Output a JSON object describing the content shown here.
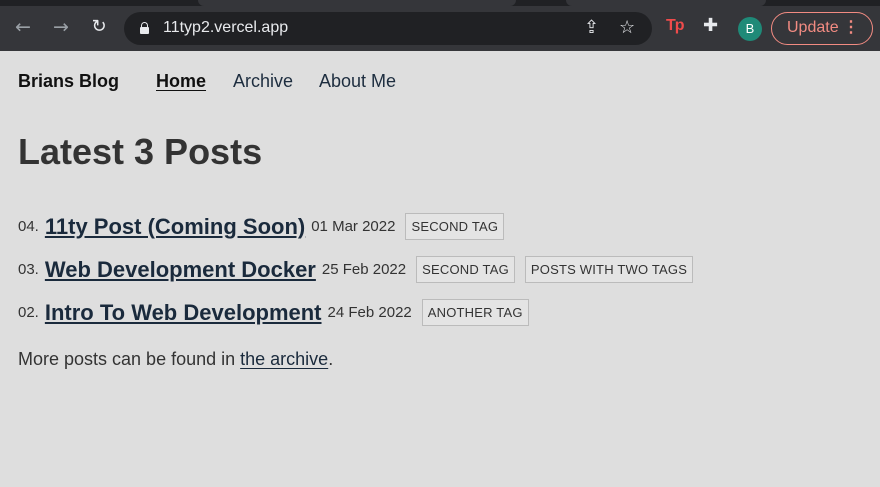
{
  "browser": {
    "url": "11typ2.vercel.app",
    "update_label": "Update",
    "avatar_letter": "B",
    "extension_label": "Tp",
    "accent_color": "#f28b82"
  },
  "site": {
    "brand": "Brians Blog",
    "nav": [
      {
        "label": "Home",
        "active": true
      },
      {
        "label": "Archive",
        "active": false
      },
      {
        "label": "About Me",
        "active": false
      }
    ]
  },
  "main": {
    "heading": "Latest 3 Posts",
    "posts": [
      {
        "number": "04.",
        "title": "11ty Post (Coming Soon)",
        "date": "01 Mar 2022",
        "tags": [
          "SECOND TAG"
        ]
      },
      {
        "number": "03.",
        "title": "Web Development Docker",
        "date": "25 Feb 2022",
        "tags": [
          "SECOND TAG",
          "POSTS WITH TWO TAGS"
        ]
      },
      {
        "number": "02.",
        "title": "Intro To Web Development",
        "date": "24 Feb 2022",
        "tags": [
          "ANOTHER TAG"
        ]
      }
    ],
    "more_prefix": "More posts can be found in ",
    "more_link": "the archive",
    "more_suffix": "."
  }
}
